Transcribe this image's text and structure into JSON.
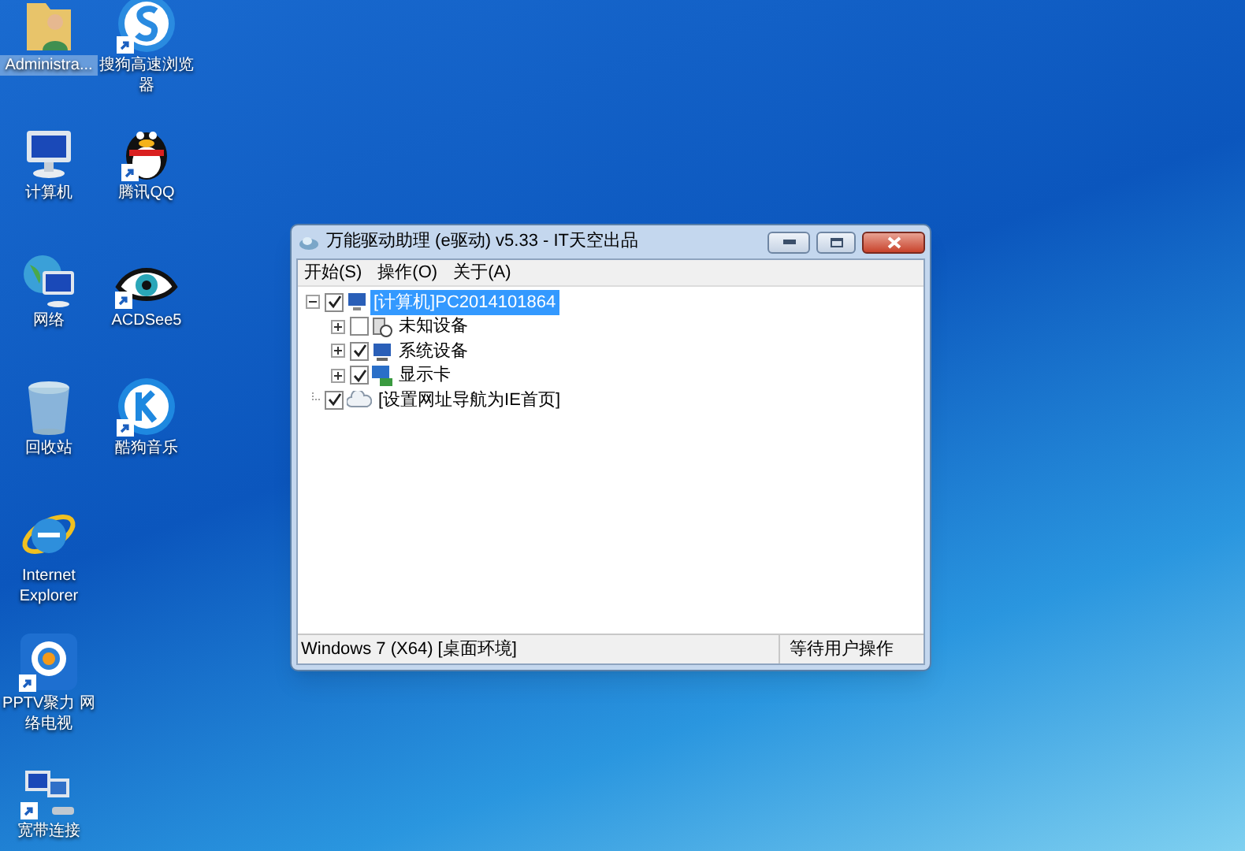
{
  "desktop": {
    "columns": [
      [
        {
          "label": "Administra...",
          "selected": true,
          "shortcut": false
        },
        {
          "label": "计算机",
          "selected": false,
          "shortcut": false
        },
        {
          "label": "网络",
          "selected": false,
          "shortcut": false
        },
        {
          "label": "回收站",
          "selected": false,
          "shortcut": false
        },
        {
          "label": "Internet Explorer",
          "selected": false,
          "shortcut": false
        },
        {
          "label": "PPTV聚力 网络电视",
          "selected": false,
          "shortcut": true
        },
        {
          "label": "宽带连接",
          "selected": false,
          "shortcut": true
        }
      ],
      [
        {
          "label": "搜狗高速浏览器",
          "selected": false,
          "shortcut": true
        },
        {
          "label": "腾讯QQ",
          "selected": false,
          "shortcut": true
        },
        {
          "label": "ACDSee5",
          "selected": false,
          "shortcut": true
        },
        {
          "label": "酷狗音乐",
          "selected": false,
          "shortcut": true
        }
      ]
    ]
  },
  "window": {
    "title": "万能驱动助理 (e驱动) v5.33 - IT天空出品",
    "menu": [
      "开始(S)",
      "操作(O)",
      "关于(A)"
    ],
    "tree": [
      {
        "label": "[计算机]PC2014101864",
        "checked": true,
        "expanded": true,
        "selected": true,
        "children": [
          {
            "label": "未知设备",
            "checked": false,
            "expanded": false,
            "selected": false,
            "has_children": true
          },
          {
            "label": "系统设备",
            "checked": true,
            "expanded": false,
            "selected": false,
            "has_children": true
          },
          {
            "label": "显示卡",
            "checked": true,
            "expanded": false,
            "selected": false,
            "has_children": true
          }
        ]
      },
      {
        "label": "[设置网址导航为IE首页]",
        "checked": true,
        "selected": false
      }
    ],
    "status_bar": [
      "Windows 7 (X64) [桌面环境]",
      "等待用户操作"
    ]
  }
}
